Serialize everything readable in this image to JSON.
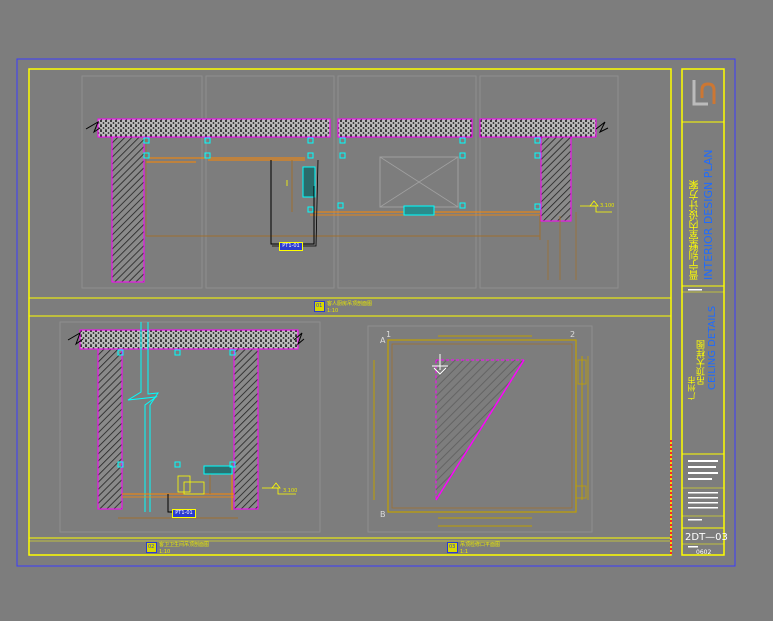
{
  "drawing": {
    "project_title_cn": "晋宁别墅室内设计方案",
    "project_title_en": "INTERIOR DESIGN PLAN",
    "location_cn": "广州市",
    "drawing_title_cn": "吊顶大样图",
    "drawing_title_en": "CEILING DETAILS",
    "sheet_number": "2DT—03",
    "scale_code": "0602"
  },
  "details": [
    {
      "no": "01",
      "title": "客人厨房吊顶剖面图",
      "scale": "1:10"
    },
    {
      "no": "02",
      "title": "客卫卫生间吊顶剖面图",
      "scale": "1:10"
    },
    {
      "no": "03",
      "title": "吊顶检修口平面图",
      "scale": "1:1"
    }
  ],
  "callouts": {
    "ceiling_level_1": "3.100",
    "ceiling_level_2": "3.100",
    "section_tag_1": "PT1-01",
    "section_tag_2": "PT1-01",
    "grid_a": "A",
    "grid_b": "B",
    "grid_1": "1",
    "grid_2": "2"
  },
  "colors": {
    "background": "#7d7d7d",
    "frame": "#ffff00",
    "outer_frame": "#3030ff",
    "wall_outline": "#ff00ff",
    "ceiling_line": "#ff8800",
    "cyan": "#00ffff"
  }
}
